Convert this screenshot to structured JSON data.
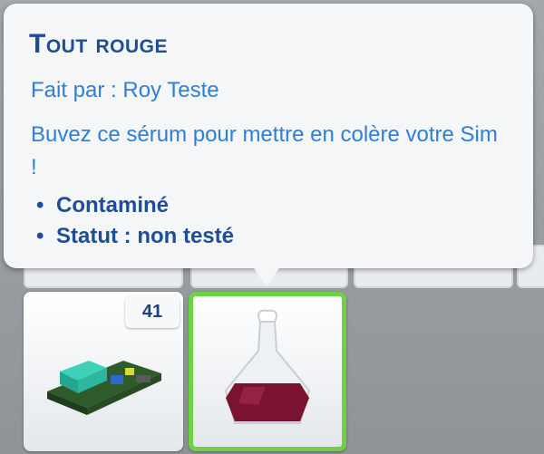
{
  "tooltip": {
    "title": "Tout rouge",
    "creator": "Fait par  : Roy Teste",
    "description": "Buvez ce sérum pour mettre en colère votre Sim  !",
    "properties": [
      "Contaminé",
      "Statut  : non testé"
    ]
  },
  "inventory": {
    "slot1": {
      "icon": "circuit-board-icon",
      "count": "41"
    },
    "slot2": {
      "icon": "potion-flask-icon",
      "selected": true
    }
  },
  "colors": {
    "title": "#1f4e96",
    "text": "#2f7fd6",
    "selected_border": "#6fd243",
    "potion_liquid": "#7a1230"
  }
}
